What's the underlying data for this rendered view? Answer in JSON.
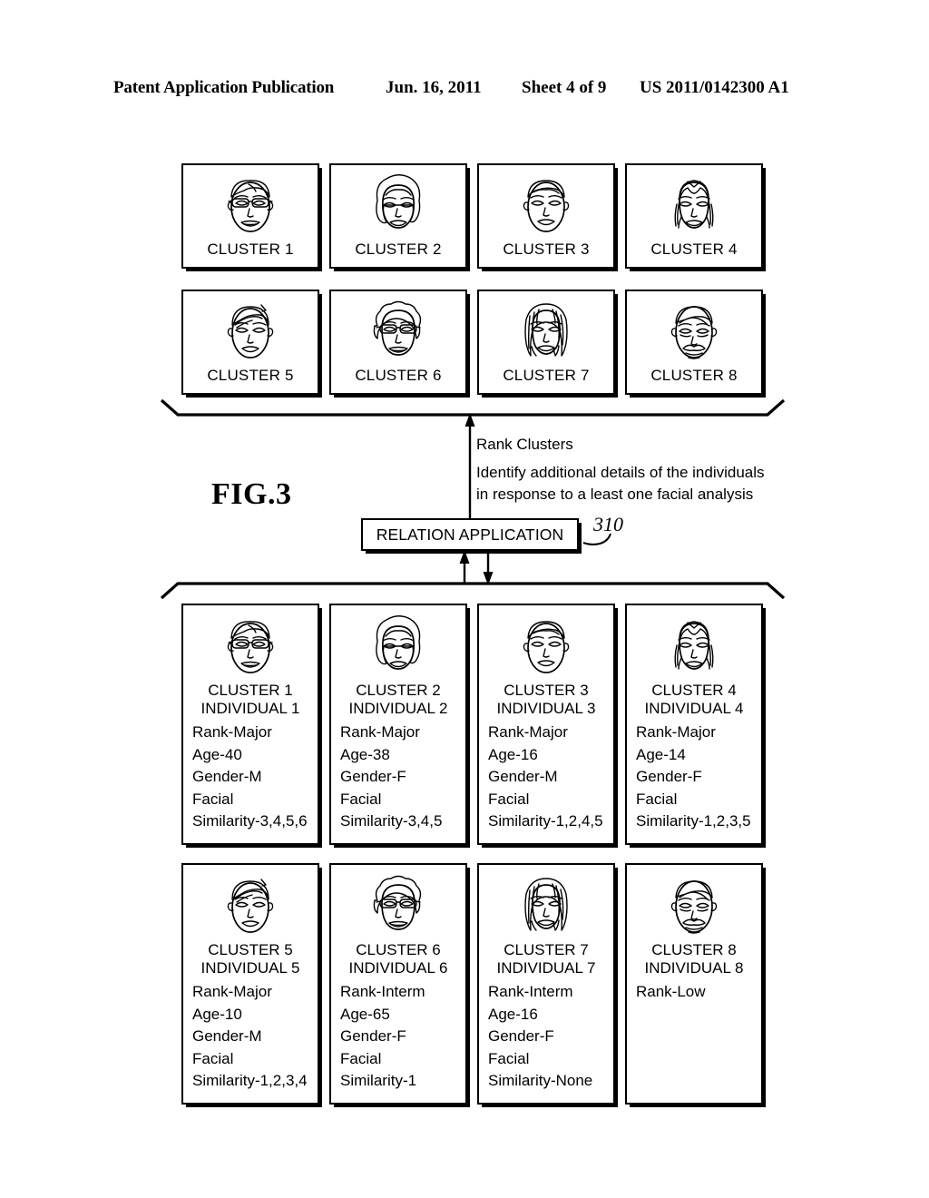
{
  "header": {
    "publication": "Patent Application Publication",
    "date": "Jun. 16, 2011",
    "sheet": "Sheet 4 of 9",
    "patent_number": "US 2011/0142300 A1"
  },
  "figure": {
    "label": "FIG.3",
    "reference_numeral": "310"
  },
  "middle": {
    "relation_application_label": "RELATION APPLICATION",
    "note_rank": "Rank Clusters",
    "note_identify_line1": "Identify additional details of the individuals",
    "note_identify_line2": "in response to a least one facial analysis"
  },
  "top_clusters": [
    {
      "label": "CLUSTER 1",
      "face": "face-glasses-short-hair"
    },
    {
      "label": "CLUSTER 2",
      "face": "face-wavy-bob"
    },
    {
      "label": "CLUSTER 3",
      "face": "face-short-crop"
    },
    {
      "label": "CLUSTER 4",
      "face": "face-long-straight-part"
    },
    {
      "label": "CLUSTER 5",
      "face": "face-swept-bangs"
    },
    {
      "label": "CLUSTER 6",
      "face": "face-glasses-curly"
    },
    {
      "label": "CLUSTER 7",
      "face": "face-long-stringy"
    },
    {
      "label": "CLUSTER 8",
      "face": "face-mustache-balding"
    }
  ],
  "detail_cards": [
    {
      "cluster": "CLUSTER 1",
      "individual": "INDIVIDUAL 1",
      "face": "face-glasses-short-hair",
      "attributes": [
        "Rank-Major",
        "Age-40",
        "Gender-M",
        "Facial",
        "Similarity-3,4,5,6"
      ]
    },
    {
      "cluster": "CLUSTER 2",
      "individual": "INDIVIDUAL 2",
      "face": "face-wavy-bob",
      "attributes": [
        "Rank-Major",
        "Age-38",
        "Gender-F",
        "Facial",
        "Similarity-3,4,5"
      ]
    },
    {
      "cluster": "CLUSTER 3",
      "individual": "INDIVIDUAL 3",
      "face": "face-short-crop",
      "attributes": [
        "Rank-Major",
        "Age-16",
        "Gender-M",
        "Facial",
        "Similarity-1,2,4,5"
      ]
    },
    {
      "cluster": "CLUSTER 4",
      "individual": "INDIVIDUAL 4",
      "face": "face-long-straight-part",
      "attributes": [
        "Rank-Major",
        "Age-14",
        "Gender-F",
        "Facial",
        "Similarity-1,2,3,5"
      ]
    },
    {
      "cluster": "CLUSTER 5",
      "individual": "INDIVIDUAL 5",
      "face": "face-swept-bangs",
      "attributes": [
        "Rank-Major",
        "Age-10",
        "Gender-M",
        "Facial",
        "Similarity-1,2,3,4"
      ]
    },
    {
      "cluster": "CLUSTER 6",
      "individual": "INDIVIDUAL 6",
      "face": "face-glasses-curly",
      "attributes": [
        "Rank-Interm",
        "Age-65",
        "Gender-F",
        "Facial",
        "Similarity-1"
      ]
    },
    {
      "cluster": "CLUSTER 7",
      "individual": "INDIVIDUAL 7",
      "face": "face-long-stringy",
      "attributes": [
        "Rank-Interm",
        "Age-16",
        "Gender-F",
        "Facial",
        "Similarity-None"
      ]
    },
    {
      "cluster": "CLUSTER 8",
      "individual": "INDIVIDUAL 8",
      "face": "face-mustache-balding",
      "attributes": [
        "Rank-Low"
      ]
    }
  ],
  "colors": {
    "ink": "#000000",
    "paper": "#ffffff"
  }
}
